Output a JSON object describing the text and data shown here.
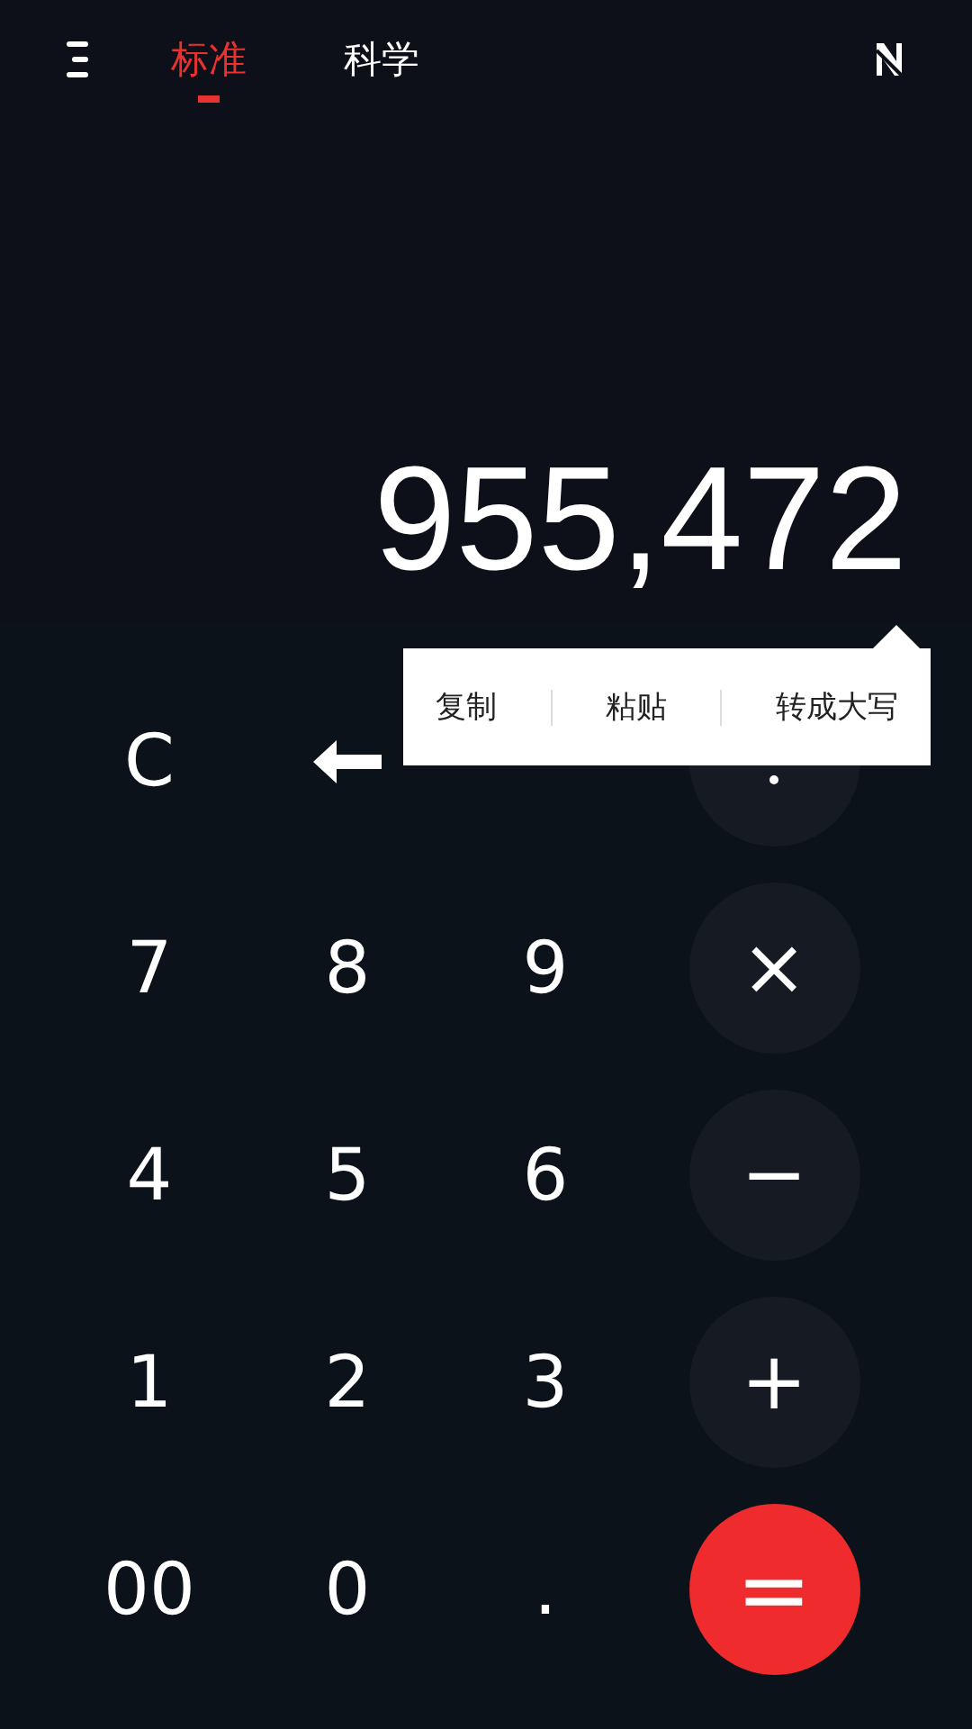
{
  "tabs": [
    {
      "label": "标准",
      "selected": true
    },
    {
      "label": "科学",
      "selected": false
    }
  ],
  "display": {
    "value": "955,472"
  },
  "context_menu": [
    "复制",
    "粘贴",
    "转成大写"
  ],
  "keys": [
    {
      "kind": "text",
      "label": "C"
    },
    {
      "kind": "backspace"
    },
    {
      "kind": "covered"
    },
    {
      "kind": "divide"
    },
    {
      "kind": "text",
      "label": "7"
    },
    {
      "kind": "text",
      "label": "8"
    },
    {
      "kind": "text",
      "label": "9"
    },
    {
      "kind": "operator",
      "label": "×"
    },
    {
      "kind": "text",
      "label": "4"
    },
    {
      "kind": "text",
      "label": "5"
    },
    {
      "kind": "text",
      "label": "6"
    },
    {
      "kind": "operator",
      "label": "−"
    },
    {
      "kind": "text",
      "label": "1"
    },
    {
      "kind": "text",
      "label": "2"
    },
    {
      "kind": "text",
      "label": "3"
    },
    {
      "kind": "operator",
      "label": "+"
    },
    {
      "kind": "text",
      "label": "00"
    },
    {
      "kind": "text",
      "label": "0"
    },
    {
      "kind": "text",
      "label": "."
    },
    {
      "kind": "equals",
      "label": "="
    }
  ]
}
